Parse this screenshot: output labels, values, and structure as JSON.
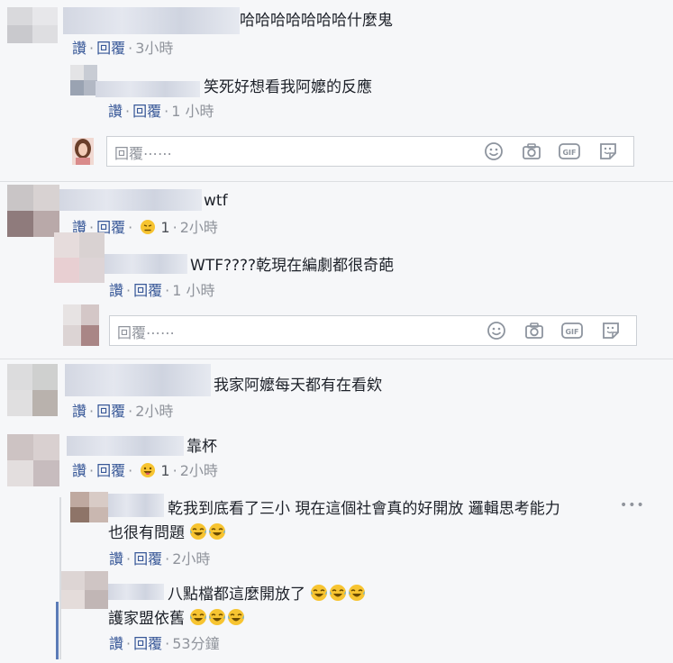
{
  "actions": {
    "like": "讚",
    "reply": "回覆",
    "sep": "·"
  },
  "reply_placeholder": "回覆⋯⋯",
  "tool_icons": [
    "emoji-icon",
    "camera-icon",
    "gif-icon",
    "sticker-icon"
  ],
  "gif_label": "GIF",
  "comments": [
    {
      "text": "哈哈哈哈哈哈哈什麼鬼",
      "time": "3小時"
    },
    {
      "text": "笑死好想看我阿嬤的反應",
      "time": "1 小時"
    },
    {
      "text": "wtf",
      "reaction_count": "1",
      "time": "2小時"
    },
    {
      "text": "WTF????乾現在編劇都很奇葩",
      "time": "1 小時"
    },
    {
      "text": "我家阿嬤每天都有在看欸",
      "time": "2小時"
    },
    {
      "text": "靠杯",
      "reaction_count": "1",
      "time": "2小時"
    },
    {
      "text_line1": "乾我到底看了三小 現在這個社會真的好開放 邏輯思考能力",
      "text_line2": "也很有問題",
      "time": "2小時"
    },
    {
      "text_line1": "八點檔都這麼開放了",
      "text_line2": "護家盟依舊",
      "time": "53分鐘"
    }
  ],
  "more_icon": "ellipsis-icon",
  "colors": {
    "link": "#385898",
    "meta": "#90949c",
    "background": "#f6f7f9"
  }
}
